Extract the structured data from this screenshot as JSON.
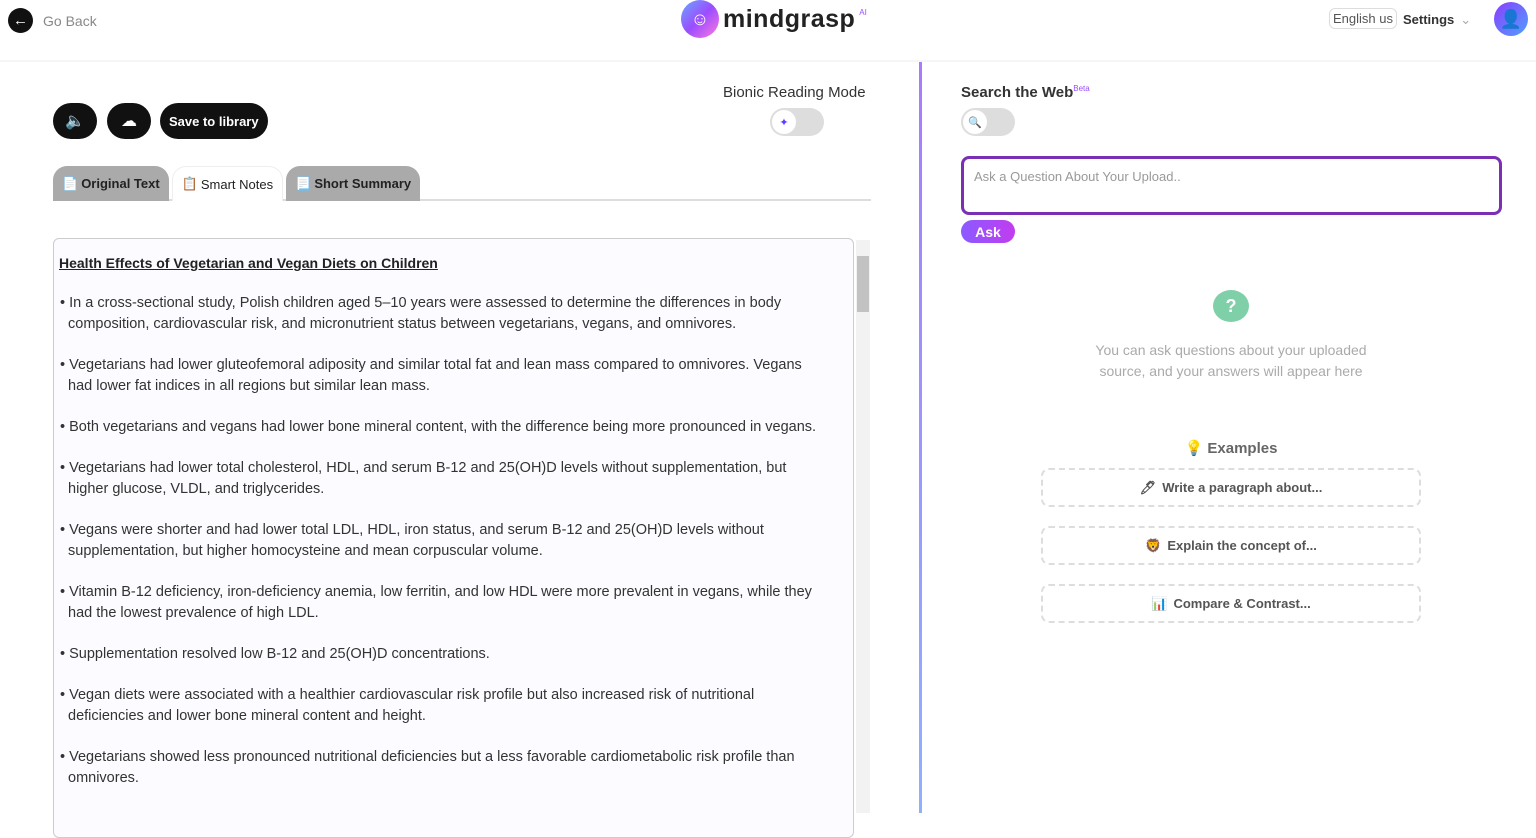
{
  "header": {
    "go_back": "Go Back",
    "logo_name": "mindgrasp",
    "logo_sup": "AI",
    "language": "English us",
    "settings": "Settings"
  },
  "toolbar": {
    "save_label": "Save to library",
    "bionic_label": "Bionic Reading Mode"
  },
  "tabs": [
    {
      "label": "Original Text",
      "active": false
    },
    {
      "label": "Smart Notes",
      "active": true
    },
    {
      "label": "Short Summary",
      "active": false
    }
  ],
  "notes": {
    "title": "Health Effects of Vegetarian and Vegan Diets on Children",
    "items": [
      "In a cross-sectional study, Polish children aged 5–10 years were assessed to determine the differences in body composition, cardiovascular risk, and micronutrient status between vegetarians, vegans, and omnivores.",
      "Vegetarians had lower gluteofemoral adiposity and similar total fat and lean mass compared to omnivores. Vegans had lower fat indices in all regions but similar lean mass.",
      "Both vegetarians and vegans had lower bone mineral content, with the difference being more pronounced in vegans.",
      "Vegetarians had lower total cholesterol, HDL, and serum B-12 and 25(OH)D levels without supplementation, but higher glucose, VLDL, and triglycerides.",
      "Vegans were shorter and had lower total LDL, HDL, iron status, and serum B-12 and 25(OH)D levels without supplementation, but higher homocysteine and mean corpuscular volume.",
      "Vitamin B-12 deficiency, iron-deficiency anemia, low ferritin, and low HDL were more prevalent in vegans, while they had the lowest prevalence of high LDL.",
      "Supplementation resolved low B-12 and 25(OH)D concentrations.",
      "Vegan diets were associated with a healthier cardiovascular risk profile but also increased risk of nutritional deficiencies and lower bone mineral content and height.",
      "Vegetarians showed less pronounced nutritional deficiencies but a less favorable cardiometabolic risk profile than omnivores."
    ]
  },
  "right": {
    "search_web": "Search the Web",
    "beta": "Beta",
    "placeholder": "Ask a Question About Your Upload..",
    "ask": "Ask",
    "hint": "You can ask questions about your uploaded source, and your answers will appear here",
    "examples_title": "💡 Examples",
    "examples": [
      {
        "icon": "🖊",
        "label": "Write a paragraph about..."
      },
      {
        "icon": "🦁",
        "label": "Explain the concept of..."
      },
      {
        "icon": "📊",
        "label": "Compare & Contrast..."
      }
    ]
  },
  "colors": {
    "accent": "#7a2fb5",
    "ask_gradient_start": "#8a5bff",
    "divider": "#a77bff"
  }
}
